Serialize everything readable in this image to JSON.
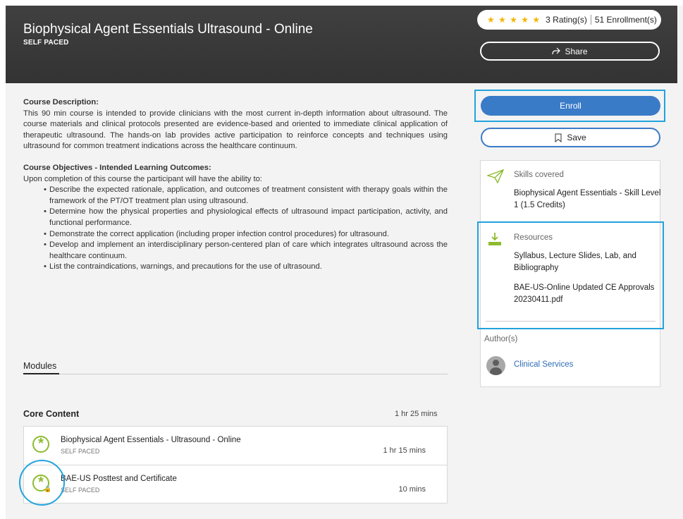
{
  "header": {
    "title": "Biophysical Agent Essentials Ultrasound - Online",
    "subtitle": "SELF PACED",
    "stars": "★ ★ ★ ★ ★",
    "rating_count": "3",
    "rating_label": "Rating(s)",
    "enrollment_count": "51",
    "enrollment_label": "Enrollment(s)",
    "share_label": "Share"
  },
  "description": {
    "heading": "Course Description:",
    "text": "This 90 min course is intended to provide clinicians with the most current in-depth information about ultrasound. The course materials and clinical protocols presented are evidence-based and oriented to immediate clinical application of therapeutic ultrasound. The hands-on lab provides active participation to reinforce concepts and techniques using ultrasound for common treatment indications across the healthcare continuum.",
    "objectives_heading": "Course Objectives - Intended Learning Outcomes:",
    "objectives_intro": "Upon completion of this course the participant will have the ability to:",
    "objectives": [
      "Describe the expected rationale, application, and outcomes of treatment consistent with therapy goals within the framework of the PT/OT treatment plan using ultrasound.",
      "Determine how the physical properties and physiological effects of ultrasound impact participation, activity, and functional performance.",
      "Demonstrate the correct application (including proper infection control procedures) for ultrasound.",
      "Develop and implement an interdisciplinary person-centered plan of care which integrates ultrasound across the healthcare continuum.",
      "List the contraindications, warnings, and precautions for the use of ultrasound."
    ]
  },
  "modules": {
    "tab_label": "Modules",
    "core_title": "Core Content",
    "core_duration": "1 hr 25 mins",
    "items": [
      {
        "name": "Biophysical Agent Essentials - Ultrasound - Online",
        "type": "SELF PACED",
        "duration": "1 hr 15 mins"
      },
      {
        "name": "BAE-US Posttest and Certificate",
        "type": "SELF PACED",
        "duration": "10 mins"
      }
    ]
  },
  "sidebar": {
    "enroll_label": "Enroll",
    "save_label": "Save",
    "skills_label": "Skills covered",
    "skills_text": "Biophysical Agent Essentials - Skill Level 1 (1.5 Credits)",
    "resources_label": "Resources",
    "resources": [
      "Syllabus, Lecture Slides, Lab, and Bibliography",
      "BAE-US-Online Updated CE Approvals 20230411.pdf"
    ],
    "authors_label": "Author(s)",
    "author_name": "Clinical Services"
  },
  "colors": {
    "accent_blue": "#3a7bc8",
    "highlight_cyan": "#22a3dd",
    "icon_green": "#8dbb2d",
    "star_gold": "#f5b400"
  }
}
